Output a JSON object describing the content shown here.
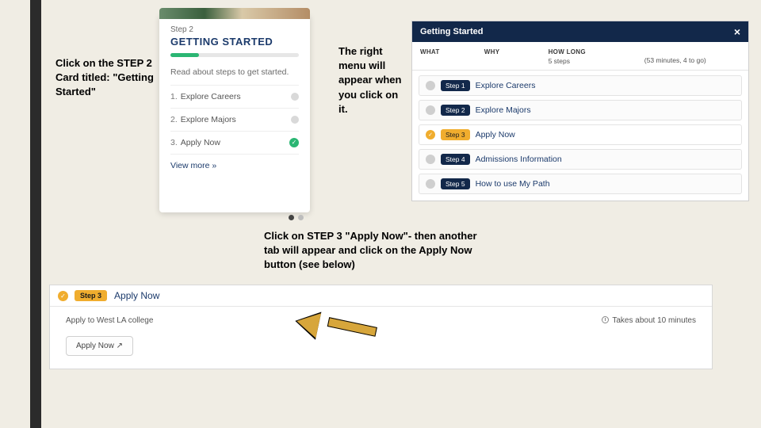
{
  "captions": {
    "c1": "Click on the STEP 2 Card titled: \"Getting Started\"",
    "c2": "The right menu will appear when you click on it.",
    "c3": "Click on STEP 3 \"Apply Now\"- then another tab will appear and click on the Apply Now button (see below)"
  },
  "card": {
    "step_label": "Step 2",
    "title": "GETTING STARTED",
    "progress_percent": 22,
    "desc": "Read about steps to get started.",
    "rows": [
      {
        "n": "1.",
        "label": "Explore Careers",
        "status": "grey"
      },
      {
        "n": "2.",
        "label": "Explore Majors",
        "status": "grey"
      },
      {
        "n": "3.",
        "label": "Apply Now",
        "status": "green"
      }
    ],
    "viewmore": "View more »"
  },
  "panel": {
    "title": "Getting Started",
    "cols": {
      "what": "WHAT",
      "why": "WHY",
      "how_label": "HOW LONG",
      "how_val": "5 steps",
      "time_val": "(53 minutes, 4 to go)"
    },
    "steps": [
      {
        "badge": "Step 1",
        "title": "Explore Careers",
        "state": "grey"
      },
      {
        "badge": "Step 2",
        "title": "Explore Majors",
        "state": "grey"
      },
      {
        "badge": "Step 3",
        "title": "Apply Now",
        "state": "amber"
      },
      {
        "badge": "Step 4",
        "title": "Admissions Information",
        "state": "grey"
      },
      {
        "badge": "Step 5",
        "title": "How to use My Path",
        "state": "grey"
      }
    ]
  },
  "strip": {
    "badge": "Step 3",
    "title": "Apply Now",
    "line": "Apply to West LA college",
    "time": "Takes about 10 minutes",
    "button": "Apply Now ↗"
  }
}
